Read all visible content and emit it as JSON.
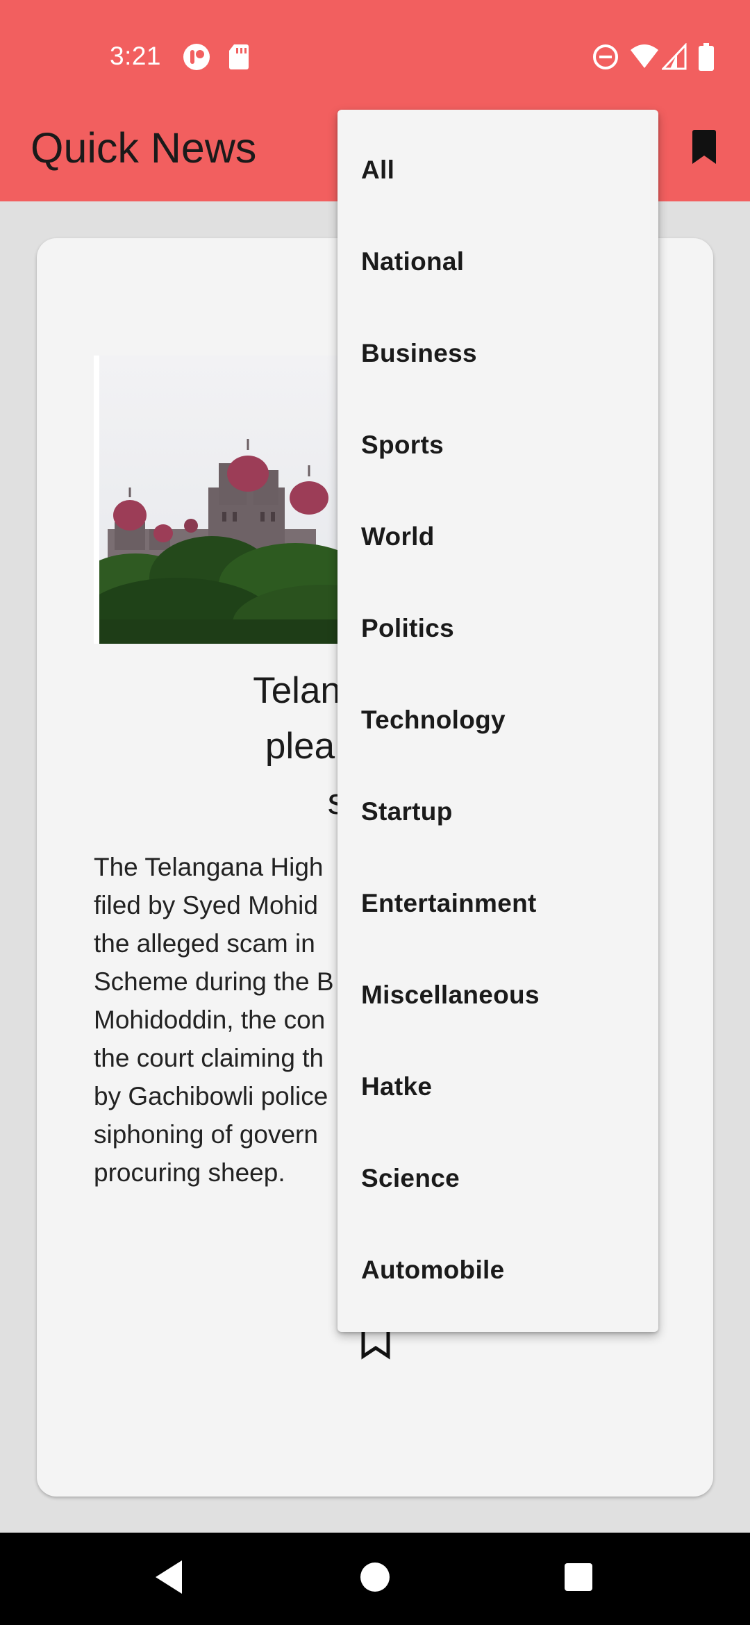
{
  "status_bar": {
    "time": "3:21",
    "icons_left": [
      "app-notification-icon",
      "sd-card-icon"
    ],
    "icons_right": [
      "do-not-disturb-icon",
      "wifi-icon",
      "signal-icon",
      "battery-icon"
    ]
  },
  "app_bar": {
    "title": "Quick News",
    "background": "#f25f5f",
    "actions": [
      "bookmark-filled-icon"
    ]
  },
  "article": {
    "headline_lines": [
      "Telangana H",
      "plea to qua",
      "sca"
    ],
    "summary_lines": [
      "The Telangana High",
      "filed by Syed Mohid",
      "the alleged scam in",
      "Scheme during the B",
      "Mohidoddin, the con",
      "the court claiming th",
      "by Gachibowli police",
      "siphoning of govern",
      "procuring sheep."
    ],
    "actions": [
      "bookmark-outline-icon"
    ]
  },
  "category_menu": {
    "items": [
      "All",
      "National",
      "Business",
      "Sports",
      "World",
      "Politics",
      "Technology",
      "Startup",
      "Entertainment",
      "Miscellaneous",
      "Hatke",
      "Science",
      "Automobile"
    ]
  },
  "nav_bar": {
    "buttons": [
      "back-icon",
      "home-icon",
      "recents-icon"
    ]
  }
}
